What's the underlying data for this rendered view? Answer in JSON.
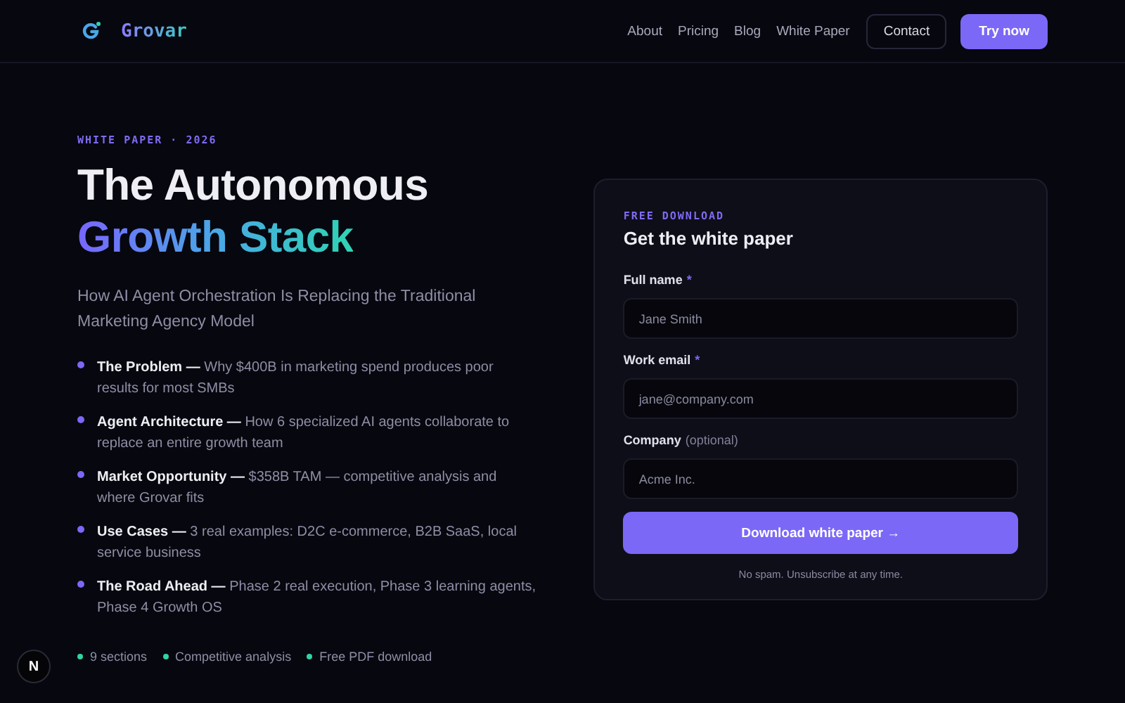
{
  "nav": {
    "brand": "Grovar",
    "links": [
      "About",
      "Pricing",
      "Blog",
      "White Paper"
    ],
    "contact": "Contact",
    "cta": "Try now"
  },
  "hero": {
    "eyebrow": "WHITE PAPER · 2026",
    "title_line1": "The Autonomous",
    "title_line2": "Growth Stack",
    "subtitle": "How AI Agent Orchestration Is Replacing the Traditional Marketing Agency Model",
    "points": [
      {
        "text": "**The Problem —** Why $400B in marketing spend produces poor results for most SMBs"
      },
      {
        "text": "**Agent Architecture —** How 6 specialized AI agents collaborate to replace an entire growth team"
      },
      {
        "text": "**Market Opportunity —** $358B TAM — competitive analysis and where Grovar fits"
      },
      {
        "text": "**Use Cases —** 3 real examples: D2C e-commerce, B2B SaaS, local service business"
      },
      {
        "text": "**The Road Ahead —** Phase 2 real execution, Phase 3 learning agents, Phase 4 Growth OS"
      }
    ],
    "meta": [
      "9 sections",
      "Competitive analysis",
      "Free PDF download"
    ]
  },
  "form": {
    "eyebrow": "FREE DOWNLOAD",
    "title": "Get the white paper",
    "fields": [
      {
        "label": "Full name",
        "required": true,
        "required_mark": "*",
        "placeholder": "Jane Smith"
      },
      {
        "label": "Work email",
        "required": true,
        "required_mark": "*",
        "placeholder": "jane@company.com"
      },
      {
        "label": "Company",
        "required": false,
        "hint": "(optional)",
        "placeholder": "Acme Inc."
      }
    ],
    "submit": "Download white paper →",
    "note": "No spam. Unsubscribe at any time."
  },
  "dev_badge": "N"
}
